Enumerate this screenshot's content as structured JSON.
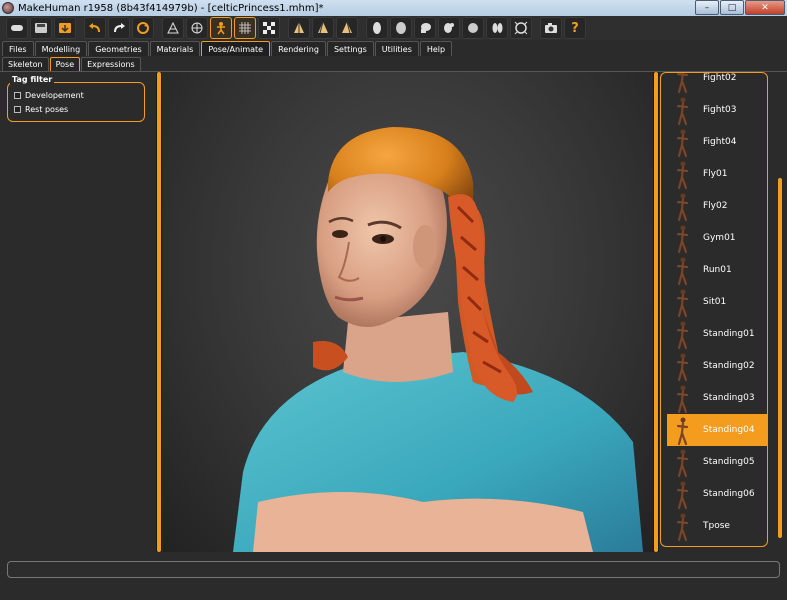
{
  "window": {
    "title": "MakeHuman r1958 (8b43f414979b) - [celticPrincess1.mhm]*",
    "min": "–",
    "max": "□",
    "close": "✕"
  },
  "toolbar": {
    "icons": [
      "undo-icon",
      "redo-icon",
      "reset-icon",
      "smooth-icon",
      "wireframe-icon",
      "pose-icon",
      "grid-icon",
      "background-icon",
      "front-view-icon",
      "side-view-icon",
      "back-view-icon",
      "face-icon",
      "head-icon",
      "skull-icon",
      "body-icon",
      "torso-icon",
      "legs-icon",
      "camera-icon",
      "help-icon"
    ],
    "help_label": "?"
  },
  "tabs": [
    "Files",
    "Modelling",
    "Geometries",
    "Materials",
    "Pose/Animate",
    "Rendering",
    "Settings",
    "Utilities",
    "Help"
  ],
  "active_tab": "Pose/Animate",
  "subtabs": [
    "Skeleton",
    "Pose",
    "Expressions"
  ],
  "active_subtab": "Pose",
  "tag_filter": {
    "title": "Tag filter",
    "options": [
      {
        "label": "Developement",
        "checked": false
      },
      {
        "label": "Rest poses",
        "checked": false
      }
    ]
  },
  "poses": [
    "Fight02",
    "Fight03",
    "Fight04",
    "Fly01",
    "Fly02",
    "Gym01",
    "Run01",
    "Sit01",
    "Standing01",
    "Standing02",
    "Standing03",
    "Standing04",
    "Standing05",
    "Standing06",
    "Tpose"
  ],
  "selected_pose": "Standing04",
  "colors": {
    "accent": "#f39c1e",
    "skin": "#e8b396",
    "hair": "#d86428",
    "helmet": "#e08a20",
    "shirt": "#4fb8c8"
  }
}
